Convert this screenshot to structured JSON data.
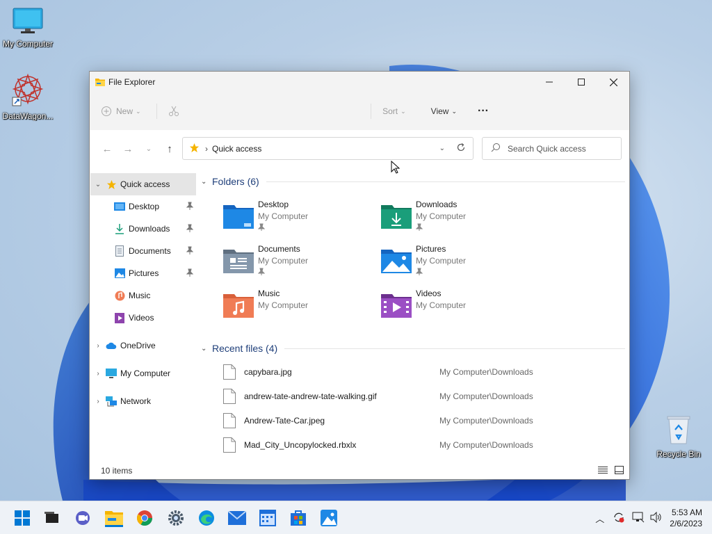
{
  "desktop": {
    "icons": [
      {
        "label": "My Computer"
      },
      {
        "label": "DataWagon..."
      },
      {
        "label": "Recycle Bin"
      }
    ]
  },
  "window": {
    "title": "File Explorer",
    "cmdbar": {
      "new_label": "New",
      "sort_label": "Sort",
      "view_label": "View",
      "more_label": "···"
    },
    "address": {
      "crumb": "Quick access",
      "search_placeholder": "Search Quick access"
    },
    "sidebar": {
      "quick_access": "Quick access",
      "items": [
        {
          "label": "Desktop",
          "pinned": true
        },
        {
          "label": "Downloads",
          "pinned": true
        },
        {
          "label": "Documents",
          "pinned": true
        },
        {
          "label": "Pictures",
          "pinned": true
        },
        {
          "label": "Music",
          "pinned": false
        },
        {
          "label": "Videos",
          "pinned": false
        }
      ],
      "roots": [
        {
          "label": "OneDrive"
        },
        {
          "label": "My Computer"
        },
        {
          "label": "Network"
        }
      ]
    },
    "folders_header": "Folders (6)",
    "folders": [
      {
        "name": "Desktop",
        "location": "My Computer",
        "pinned": true
      },
      {
        "name": "Downloads",
        "location": "My Computer",
        "pinned": true
      },
      {
        "name": "Documents",
        "location": "My Computer",
        "pinned": true
      },
      {
        "name": "Pictures",
        "location": "My Computer",
        "pinned": true
      },
      {
        "name": "Music",
        "location": "My Computer",
        "pinned": false
      },
      {
        "name": "Videos",
        "location": "My Computer",
        "pinned": false
      }
    ],
    "recent_header": "Recent files (4)",
    "recent_files": [
      {
        "name": "capybara.jpg",
        "path": "My Computer\\Downloads"
      },
      {
        "name": "andrew-tate-andrew-tate-walking.gif",
        "path": "My Computer\\Downloads"
      },
      {
        "name": "Andrew-Tate-Car.jpeg",
        "path": "My Computer\\Downloads"
      },
      {
        "name": "Mad_City_Uncopylocked.rbxlx",
        "path": "My Computer\\Downloads"
      }
    ],
    "status": "10 items"
  },
  "taskbar": {
    "time": "5:53 AM",
    "date": "2/6/2023"
  },
  "colors": {
    "accent": "#0067c0",
    "folder_blue": "#1e88e5",
    "folder_teal": "#1a9e7a"
  }
}
